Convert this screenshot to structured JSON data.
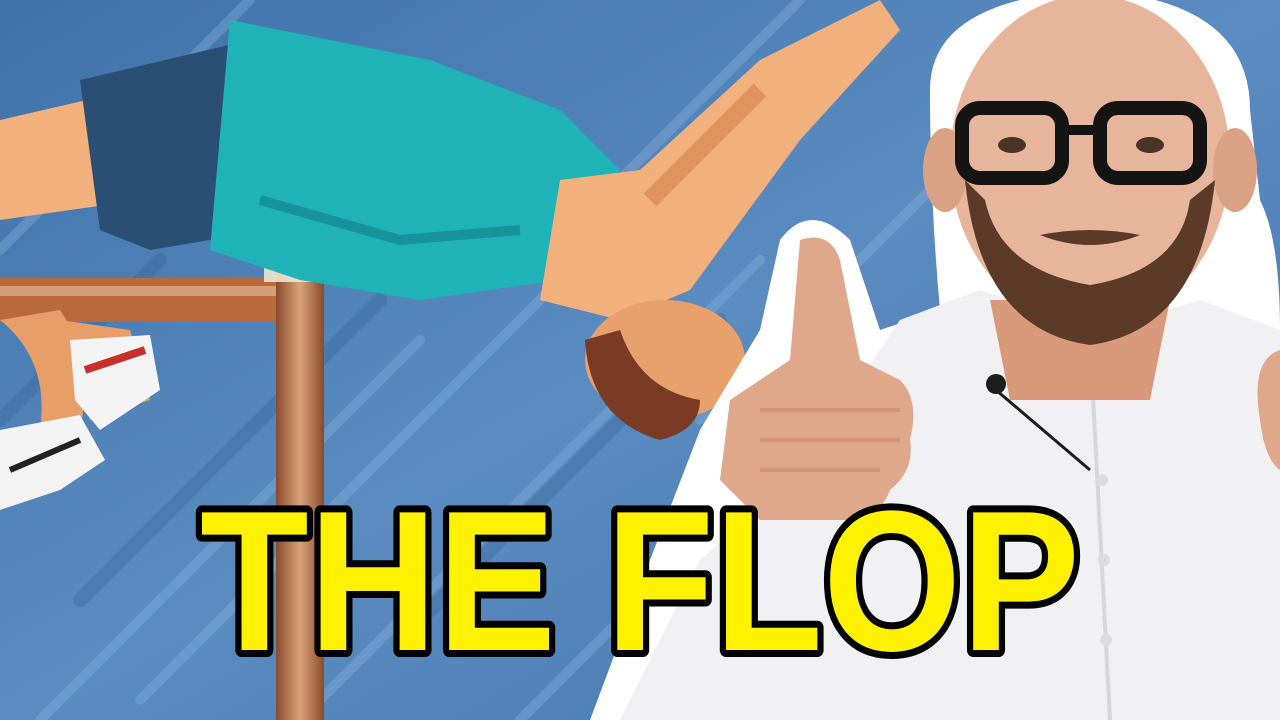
{
  "thumbnail": {
    "title_text": "THE FLOP",
    "colors": {
      "background": "#4f82b8",
      "title_fill": "#fff200",
      "title_stroke": "#000000",
      "shirt": "#1fb3b8",
      "shorts": "#2b4f74",
      "skin": "#f2b07c",
      "bar": "#b86a3c"
    }
  }
}
